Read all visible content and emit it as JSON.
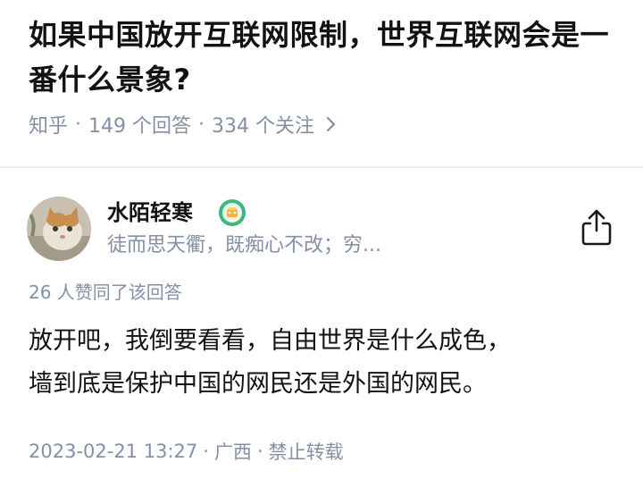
{
  "question": {
    "title": "如果中国放开互联网限制，世界互联网会是一番什么景象?",
    "source": "知乎",
    "answers": "149 个回答",
    "followers": "334 个关注",
    "separator": "·"
  },
  "author": {
    "name": "水陌轻寒",
    "bio": "徒而思天衢，既痴心不改；穷...",
    "avatar_icon": "cat-avatar",
    "badge_icon": "achievement-badge-icon"
  },
  "answer": {
    "likes": "26 人赞同了该回答",
    "paragraphs": [
      "放开吧，我倒要看看，自由世界是什么成色，",
      "墙到底是保护中国的网民还是外国的网民。"
    ],
    "timestamp": "2023-02-21 13:27",
    "location": "广西",
    "copyright": "禁止转载",
    "separator": "·"
  },
  "colors": {
    "text_primary": "#121212",
    "text_secondary": "#8590a6",
    "divider": "#f0f0f2",
    "badge_green": "#3fb67a"
  }
}
